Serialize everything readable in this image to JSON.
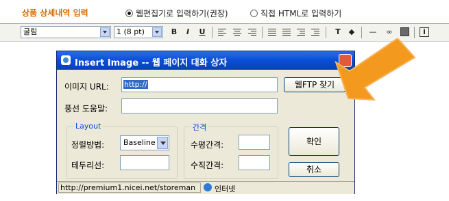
{
  "header": {
    "title": "상품 상세내역 입력",
    "option_web": "웹편집기로 입력하기(권장)",
    "option_html": "직접 HTML로 입력하기"
  },
  "toolbar": {
    "font": "굴림",
    "size": "1 (8 pt)",
    "bold": "B",
    "italic": "I",
    "underline": "U"
  },
  "dialog": {
    "title": "Insert Image -- 웹 페이지 대화 상자",
    "image_url_label": "이미지 URL:",
    "image_url_value": "http://",
    "tooltip_label": "풍선 도움말:",
    "webftp_button": "웹FTP 찾기",
    "layout_group": "Layout",
    "align_label": "정렬방법:",
    "align_value": "Baseline",
    "border_label": "테두리선:",
    "spacing_group": "간격",
    "hspace_label": "수평간격:",
    "vspace_label": "수직간격:",
    "ok_button": "확인",
    "cancel_button": "취소",
    "status_url": "http://premium1.nicei.net/storeman",
    "status_zone": "인터넷"
  },
  "colors": {
    "accent": "#d46a00",
    "titlebar": "#0a4ed8",
    "highlight": "#ffa028"
  }
}
